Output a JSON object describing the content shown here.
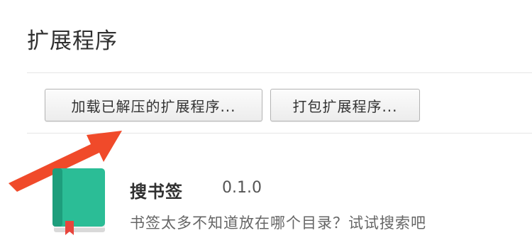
{
  "page": {
    "title": "扩展程序"
  },
  "toolbar": {
    "load_unpacked_label": "加载已解压的扩展程序...",
    "pack_label": "打包扩展程序..."
  },
  "annotation": {
    "arrow_color": "#f04a2a"
  },
  "extension": {
    "name": "搜书签",
    "version": "0.1.0",
    "description": "书签太多不知道放在哪个目录？试试搜索吧",
    "icon": "book-bookmark-icon",
    "icon_color": "#2bbd96"
  }
}
